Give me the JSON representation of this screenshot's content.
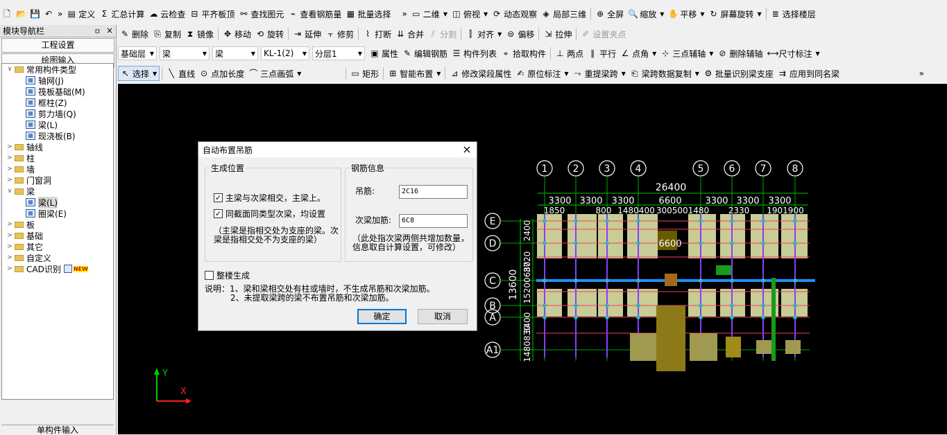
{
  "colors": {
    "canvas": "#000000",
    "grid_circle": "#ffffff",
    "dim_text": "#ffffff",
    "accent": "#0078d7"
  },
  "toolbar1": {
    "quick_icons": [
      "new-file-icon",
      "open-folder-icon",
      "save-icon",
      "undo-icon"
    ],
    "overflow": "»",
    "items": [
      {
        "label": "定义",
        "icon": "define-icon"
      },
      {
        "label": "汇总计算",
        "icon": "sigma-icon"
      },
      {
        "label": "云检查",
        "icon": "cloud-check-icon"
      },
      {
        "label": "平齐板顶",
        "icon": "align-slab-icon"
      },
      {
        "label": "查找图元",
        "icon": "binoculars-icon"
      },
      {
        "label": "查看钢筋量",
        "icon": "rebar-view-icon"
      },
      {
        "label": "批量选择",
        "icon": "batch-select-icon"
      }
    ],
    "view_items": [
      {
        "label": "二维",
        "icon": "2d-icon"
      },
      {
        "label": "俯视",
        "icon": "top-view-icon"
      },
      {
        "label": "动态观察",
        "icon": "orbit-icon"
      },
      {
        "label": "局部三维",
        "icon": "local-3d-icon"
      },
      {
        "label": "全屏",
        "icon": "fullscreen-icon"
      },
      {
        "label": "缩放",
        "icon": "zoom-icon"
      },
      {
        "label": "平移",
        "icon": "pan-icon"
      },
      {
        "label": "屏幕旋转",
        "icon": "rotate-screen-icon"
      },
      {
        "label": "选择楼层",
        "icon": "floor-select-icon"
      }
    ]
  },
  "toolbar2": [
    {
      "label": "删除",
      "icon": "delete-icon"
    },
    {
      "label": "复制",
      "icon": "copy-icon"
    },
    {
      "label": "镜像",
      "icon": "mirror-icon"
    },
    {
      "label": "移动",
      "icon": "move-icon"
    },
    {
      "label": "旋转",
      "icon": "rotate-icon"
    },
    {
      "label": "延伸",
      "icon": "extend-icon"
    },
    {
      "label": "修剪",
      "icon": "trim-icon"
    },
    {
      "label": "打断",
      "icon": "break-icon"
    },
    {
      "label": "合并",
      "icon": "merge-icon"
    },
    {
      "label": "分割",
      "icon": "split-icon"
    },
    {
      "label": "对齐",
      "icon": "align-icon"
    },
    {
      "label": "偏移",
      "icon": "offset-icon"
    },
    {
      "label": "拉伸",
      "icon": "stretch-icon"
    },
    {
      "label": "设置夹点",
      "icon": "grip-icon"
    }
  ],
  "toolbar3": {
    "selects": [
      "基础层",
      "梁",
      "梁",
      "KL-1(2)",
      "分层1"
    ],
    "items": [
      {
        "label": "属性",
        "icon": "properties-icon"
      },
      {
        "label": "编辑钢筋",
        "icon": "edit-rebar-icon"
      },
      {
        "label": "构件列表",
        "icon": "component-list-icon"
      },
      {
        "label": "拾取构件",
        "icon": "pick-icon"
      },
      {
        "label": "两点",
        "icon": "two-point-icon"
      },
      {
        "label": "平行",
        "icon": "parallel-icon"
      },
      {
        "label": "点角",
        "icon": "point-angle-icon"
      },
      {
        "label": "三点辅轴",
        "icon": "three-point-axis-icon"
      },
      {
        "label": "删除辅轴",
        "icon": "delete-axis-icon"
      },
      {
        "label": "尺寸标注",
        "icon": "dimension-icon"
      }
    ]
  },
  "toolbar4": {
    "items": [
      {
        "label": "选择",
        "icon": "cursor-icon"
      },
      {
        "label": "直线",
        "icon": "line-icon"
      },
      {
        "label": "点加长度",
        "icon": "point-length-icon"
      },
      {
        "label": "三点画弧",
        "icon": "arc-icon"
      },
      {
        "label": "矩形",
        "icon": "rectangle-icon"
      },
      {
        "label": "智能布置",
        "icon": "smart-layout-icon"
      },
      {
        "label": "修改梁段属性",
        "icon": "beam-segment-icon"
      },
      {
        "label": "原位标注",
        "icon": "in-situ-label-icon"
      },
      {
        "label": "重提梁跨",
        "icon": "beam-span-icon"
      },
      {
        "label": "梁跨数据复制",
        "icon": "span-copy-icon"
      },
      {
        "label": "批量识别梁支座",
        "icon": "batch-support-icon"
      },
      {
        "label": "应用到同名梁",
        "icon": "apply-same-name-icon"
      }
    ],
    "overflow": "»"
  },
  "nav": {
    "title": "模块导航栏",
    "pin": "ㅁ",
    "close": "×",
    "tabs": [
      "工程设置",
      "绘图输入"
    ],
    "add": "+",
    "remove": "−",
    "tree": [
      {
        "label": "常用构件类型",
        "level": 0,
        "type": "folder",
        "exp": "∨"
      },
      {
        "label": "轴网(J)",
        "level": 1,
        "type": "comp"
      },
      {
        "label": "筏板基础(M)",
        "level": 1,
        "type": "comp"
      },
      {
        "label": "框柱(Z)",
        "level": 1,
        "type": "comp"
      },
      {
        "label": "剪力墙(Q)",
        "level": 1,
        "type": "comp"
      },
      {
        "label": "梁(L)",
        "level": 1,
        "type": "comp"
      },
      {
        "label": "现浇板(B)",
        "level": 1,
        "type": "comp"
      },
      {
        "label": "轴线",
        "level": 0,
        "type": "folder",
        "exp": ">"
      },
      {
        "label": "柱",
        "level": 0,
        "type": "folder",
        "exp": ">"
      },
      {
        "label": "墙",
        "level": 0,
        "type": "folder",
        "exp": ">"
      },
      {
        "label": "门窗洞",
        "level": 0,
        "type": "folder",
        "exp": ">"
      },
      {
        "label": "梁",
        "level": 0,
        "type": "folder",
        "exp": "∨"
      },
      {
        "label": "梁(L)",
        "level": 1,
        "type": "comp",
        "hl": true
      },
      {
        "label": "圈梁(E)",
        "level": 1,
        "type": "comp"
      },
      {
        "label": "板",
        "level": 0,
        "type": "folder",
        "exp": ">"
      },
      {
        "label": "基础",
        "level": 0,
        "type": "folder",
        "exp": ">"
      },
      {
        "label": "其它",
        "level": 0,
        "type": "folder",
        "exp": ">"
      },
      {
        "label": "自定义",
        "level": 0,
        "type": "folder",
        "exp": ">"
      },
      {
        "label": "CAD识别",
        "level": 0,
        "type": "folder",
        "exp": ">",
        "badge": "NEW"
      }
    ],
    "bottom": "单构件输入"
  },
  "dialog": {
    "title": "自动布置吊筋",
    "close": "×",
    "group1": {
      "title": "生成位置",
      "opt1": "主梁与次梁相交，主梁上。",
      "opt2": "同截面同类型次梁，均设置",
      "note": "（主梁是指相交处为支座的梁。次梁是指相交处不为支座的梁）"
    },
    "group2": {
      "title": "钢筋信息",
      "label1": "吊筋:",
      "value1": "2C16",
      "label2": "次梁加筋:",
      "value2": "6C8",
      "note": "（此处指次梁两侧共增加数量，信息取自计算设置，可修改）"
    },
    "whole": "整楼生成",
    "desc1": "说明：1、梁和梁相交处有柱或墙时，不生成吊筋和次梁加筋。",
    "desc2": "2、未提取梁跨的梁不布置吊筋和次梁加筋。",
    "ok": "确定",
    "cancel": "取消"
  },
  "drawing": {
    "col_axes": [
      "1",
      "2",
      "3",
      "4",
      "5",
      "6",
      "7",
      "8"
    ],
    "row_axes": [
      "E",
      "D",
      "C",
      "B",
      "A",
      "A1"
    ],
    "total_dim": "26400",
    "top_dims": [
      "3300",
      "3300",
      "3300",
      "6600",
      "3300",
      "3300",
      "3300"
    ],
    "sub_dims": [
      "1850",
      "800",
      "1480400",
      "3005001480",
      "2330",
      "1901900"
    ],
    "left_total": "13600",
    "left_dims": [
      "2400",
      "3720",
      "15200680",
      "3400",
      "1480830"
    ],
    "center_label": "6600",
    "ucs_y": "Y",
    "ucs_x": "X"
  }
}
